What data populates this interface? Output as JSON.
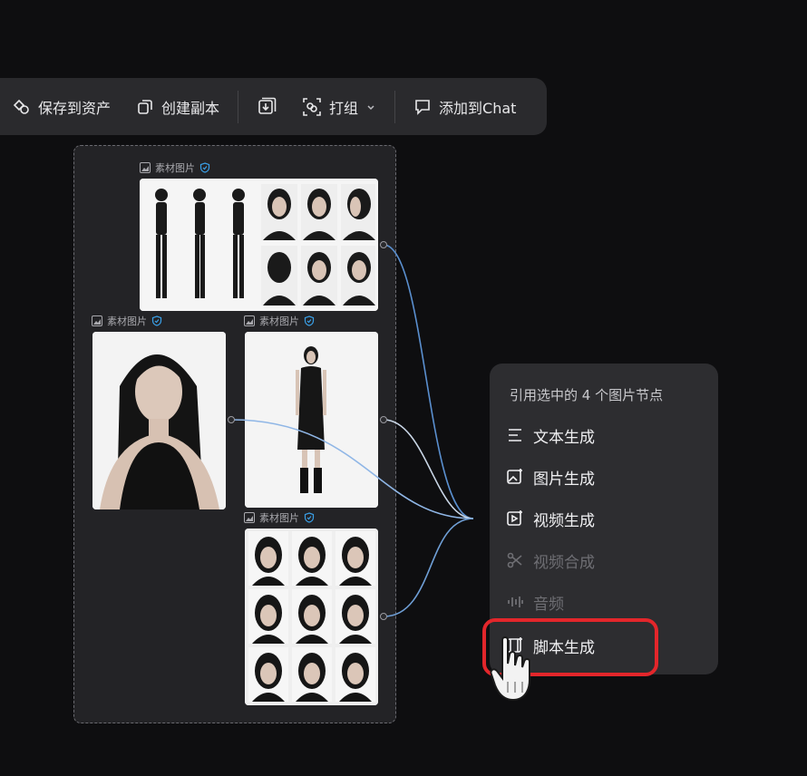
{
  "toolbar": {
    "save_asset": "保存到资产",
    "duplicate": "创建副本",
    "group": "打组",
    "add_chat": "添加到Chat"
  },
  "nodes": {
    "label": "素材图片"
  },
  "menu": {
    "title": "引用选中的 4 个图片节点",
    "items": [
      {
        "label": "文本生成",
        "icon": "text-lines-icon",
        "enabled": true
      },
      {
        "label": "图片生成",
        "icon": "image-sparkle-icon",
        "enabled": true
      },
      {
        "label": "视频生成",
        "icon": "video-sparkle-icon",
        "enabled": true
      },
      {
        "label": "视频合成",
        "icon": "scissors-icon",
        "enabled": false
      },
      {
        "label": "音频",
        "icon": "audio-wave-icon",
        "enabled": false
      },
      {
        "label": "脚本生成",
        "icon": "script-film-icon",
        "enabled": true
      }
    ]
  },
  "colors": {
    "accent_wire": "#4a90d9",
    "highlight": "#e3262b",
    "verified": "#3aa0e8"
  }
}
